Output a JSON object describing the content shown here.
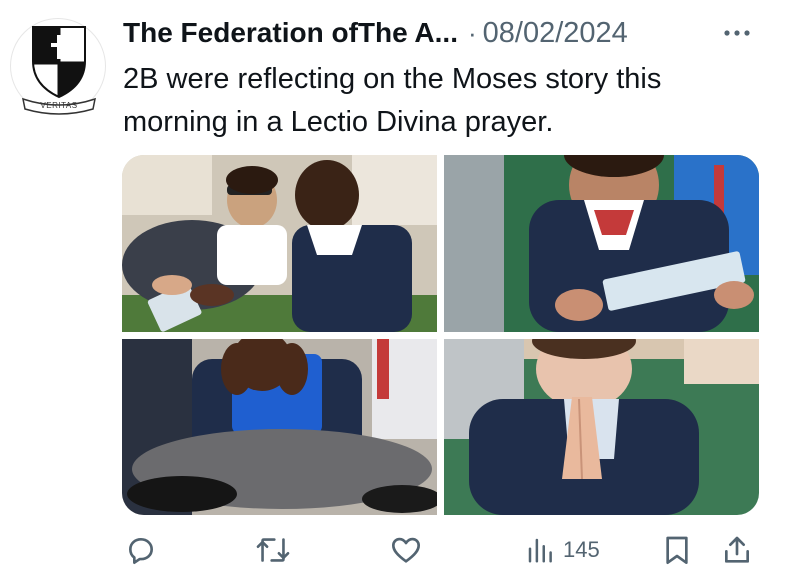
{
  "tweet": {
    "author_name": "The Federation ofThe A...",
    "separator": "·",
    "date": "08/02/2024",
    "text": "2B were reflecting on the Moses story this morning in a Lectio Divina prayer."
  },
  "avatar": {
    "motto": "VERITAS"
  },
  "media": {
    "photos": [
      {
        "label": "children-reading-prayer-cards"
      },
      {
        "label": "child-holding-prayer-card"
      },
      {
        "label": "child-praying-hands-to-face"
      },
      {
        "label": "child-praying-hands-together"
      }
    ]
  },
  "actions": {
    "reply_icon": "reply-icon",
    "retweet_icon": "retweet-icon",
    "like_icon": "heart-icon",
    "views_icon": "views-icon",
    "views_count": "145",
    "bookmark_icon": "bookmark-icon",
    "share_icon": "share-icon"
  },
  "colors": {
    "text_primary": "#0f1419",
    "text_secondary": "#536471",
    "icon": "#536471",
    "uniform_navy": "#1f2d4a",
    "uniform_blue": "#1f5fd0"
  }
}
